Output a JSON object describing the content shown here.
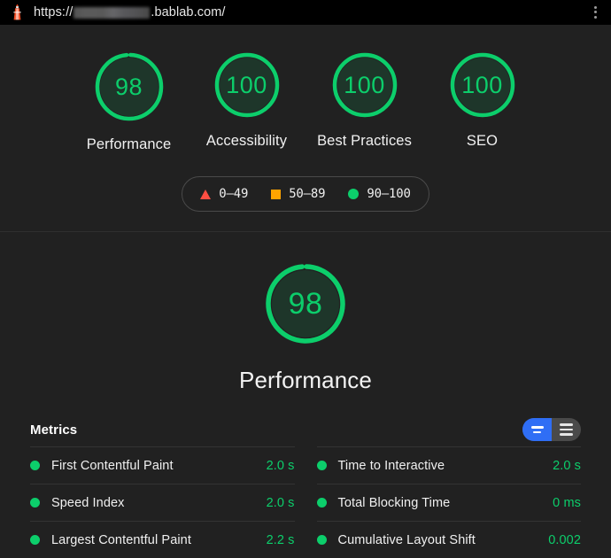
{
  "topbar": {
    "logo_icon": "lighthouse-icon",
    "url_prefix": "https://",
    "url_redacted": true,
    "url_suffix": ".bablab.com/",
    "menu_icon": "kebab-menu-icon"
  },
  "summary": {
    "gauges": [
      {
        "score": "98",
        "label": "Performance",
        "percent": 98,
        "color": "#0cce6b"
      },
      {
        "score": "100",
        "label": "Accessibility",
        "percent": 100,
        "color": "#0cce6b"
      },
      {
        "score": "100",
        "label": "Best Practices",
        "percent": 100,
        "color": "#0cce6b"
      },
      {
        "score": "100",
        "label": "SEO",
        "percent": 100,
        "color": "#0cce6b"
      }
    ],
    "legend": [
      {
        "shape": "triangle",
        "range": "0–49",
        "color": "#ff4e42"
      },
      {
        "shape": "square",
        "range": "50–89",
        "color": "#ffa400"
      },
      {
        "shape": "circle",
        "range": "90–100",
        "color": "#0cce6b"
      }
    ]
  },
  "detail": {
    "gauge": {
      "score": "98",
      "percent": 98,
      "color": "#0cce6b"
    },
    "title": "Performance",
    "metrics_heading": "Metrics",
    "toggle": {
      "active": "summary",
      "options": [
        {
          "id": "summary",
          "icon": "two-line-view-icon",
          "active": true
        },
        {
          "id": "expanded",
          "icon": "three-line-view-icon",
          "active": false
        }
      ],
      "active_color": "#2f6ef5"
    },
    "metrics": [
      {
        "name": "First Contentful Paint",
        "value": "2.0 s",
        "status": "pass"
      },
      {
        "name": "Time to Interactive",
        "value": "2.0 s",
        "status": "pass"
      },
      {
        "name": "Speed Index",
        "value": "2.0 s",
        "status": "pass"
      },
      {
        "name": "Total Blocking Time",
        "value": "0 ms",
        "status": "pass"
      },
      {
        "name": "Largest Contentful Paint",
        "value": "2.2 s",
        "status": "pass"
      },
      {
        "name": "Cumulative Layout Shift",
        "value": "0.002",
        "status": "pass"
      }
    ]
  }
}
